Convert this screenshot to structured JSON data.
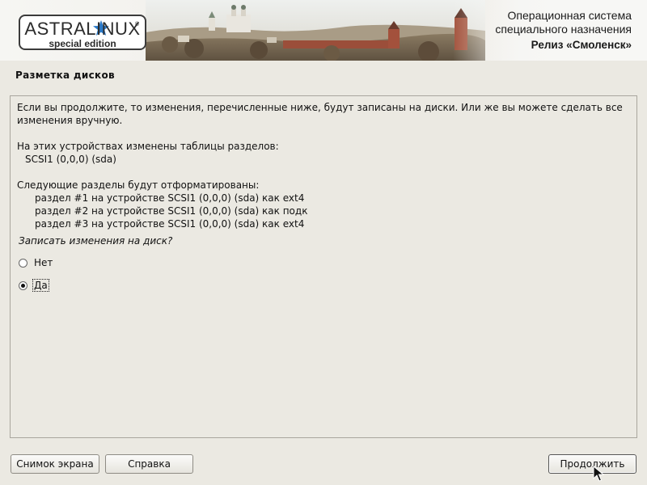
{
  "header": {
    "logo_main": "ASTRALINUX",
    "logo_registered": "®",
    "logo_sub": "special edition",
    "os_line1": "Операционная система",
    "os_line2": "специального назначения",
    "release": "Релиз «Смоленск»"
  },
  "page_title": "Разметка дисков",
  "content": {
    "intro_line1": "Если вы продолжите, то изменения, перечисленные ниже, будут записаны на диски. Или же вы можете сделать все",
    "intro_line2": "изменения вручную.",
    "tables_header": "На этих устройствах изменены таблицы разделов:",
    "tables_device": "SCSI1 (0,0,0) (sda)",
    "format_header": "Следующие разделы будут отформатированы:",
    "partitions": [
      "раздел #1 на устройстве SCSI1 (0,0,0) (sda) как ext4",
      "раздел #2 на устройстве SCSI1 (0,0,0) (sda) как подк",
      "раздел #3 на устройстве SCSI1 (0,0,0) (sda) как ext4"
    ],
    "question": "Записать изменения на диск?",
    "options": [
      {
        "label": "Нет",
        "selected": false
      },
      {
        "label": "Да",
        "selected": true
      }
    ]
  },
  "buttons": {
    "screenshot": "Снимок экрана",
    "help": "Справка",
    "continue": "Продолжить"
  },
  "colors": {
    "background": "#ebe9e2",
    "logo_star": "#2a79c8"
  }
}
